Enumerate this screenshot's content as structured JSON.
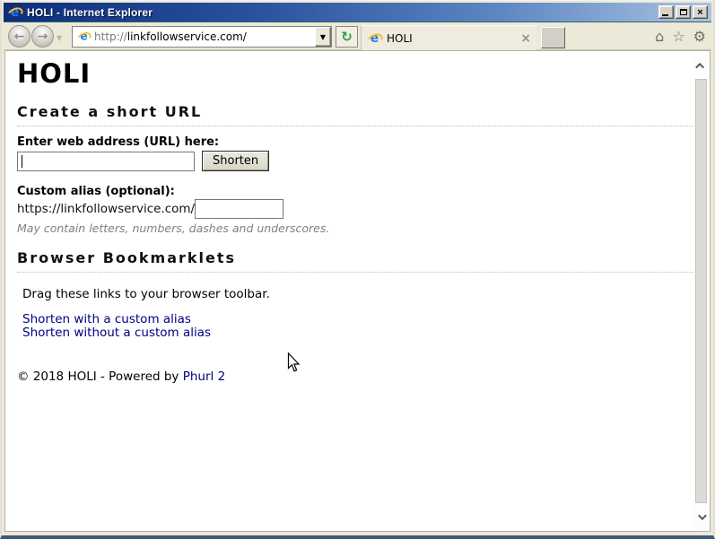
{
  "window": {
    "title": "HOLI - Internet Explorer"
  },
  "toolbar": {
    "address": {
      "protocol": "http://",
      "host": "linkfollowservice.com/"
    },
    "tab": {
      "title": "HOLI"
    }
  },
  "icons": {
    "ie_logo": "e",
    "back": "←",
    "forward": "→",
    "history_dropdown": "▼",
    "address_dropdown": "▼",
    "refresh": "↻",
    "tab_close": "×",
    "home": "⌂",
    "favorites": "☆",
    "settings": "⚙",
    "window_close": "×"
  },
  "page": {
    "heading": "HOLI",
    "create_section": {
      "title": "Create a short URL",
      "url_label": "Enter web address (URL) here:",
      "url_value": "",
      "shorten_button": "Shorten",
      "alias_label": "Custom alias (optional):",
      "alias_prefix": "https://linkfollowservice.com/",
      "alias_value": "",
      "alias_hint": "May contain letters, numbers, dashes and underscores."
    },
    "bookmarklets_section": {
      "title": "Browser Bookmarklets",
      "instruction": "Drag these links to your browser toolbar.",
      "links": [
        "Shorten with a custom alias",
        "Shorten without a custom alias"
      ]
    },
    "footer": {
      "copyright": "© 2018 HOLI - Powered by ",
      "powered_link": "Phurl 2"
    }
  },
  "colors": {
    "link": "#000080",
    "titlebar_gradient_start": "#0f2d7a",
    "titlebar_gradient_end": "#a9c3e2",
    "toolbar_bg": "#ece9d8",
    "hint_text": "#808080"
  }
}
